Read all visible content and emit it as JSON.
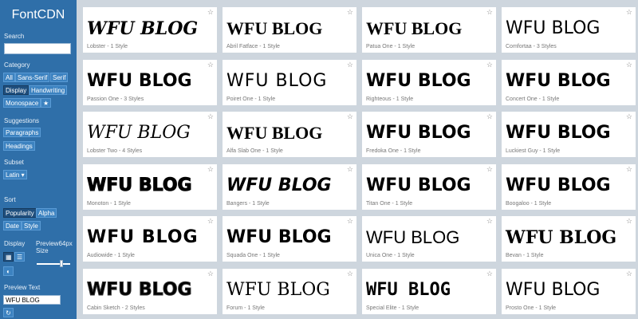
{
  "sidebar": {
    "title": "FontCDN",
    "search_label": "Search",
    "search_value": "",
    "category_label": "Category",
    "category_buttons": [
      "All",
      "Sans-Serif",
      "Serif",
      "Display",
      "Handwriting",
      "Monospace"
    ],
    "category_active": "Display",
    "favorites_icon": "star-icon",
    "suggestions_label": "Suggestions",
    "suggestion_buttons": [
      "Paragraphs",
      "Headings"
    ],
    "subset_label": "Subset",
    "subset_value": "Latin",
    "sort_label": "Sort",
    "sort_buttons": [
      "Popularity",
      "Alpha",
      "Date",
      "Style"
    ],
    "sort_active": "Popularity",
    "display_label": "Display",
    "display_icons": [
      "grid-view-icon",
      "list-view-icon",
      "contrast-icon"
    ],
    "preview_size_label": "Preview64px Size",
    "preview_size_value": "64px",
    "preview_text_label": "Preview Text",
    "preview_text_value": "WFU BLOG",
    "refresh_icon": "refresh-icon"
  },
  "preview_text": "WFU BLOG",
  "fonts": [
    {
      "name": "Lobster",
      "styles": "1 Style",
      "caption": "Lobster - 1 Style",
      "font_class": "f-lobster"
    },
    {
      "name": "Abril Fatface",
      "styles": "1 Style",
      "caption": "Abril Fatface - 1 Style",
      "font_class": "f-abril"
    },
    {
      "name": "Patua One",
      "styles": "1 Style",
      "caption": "Patua One - 1 Style",
      "font_class": "f-patua"
    },
    {
      "name": "Comfortaa",
      "styles": "3 Styles",
      "caption": "Comfortaa - 3 Styles",
      "font_class": "f-comfortaa"
    },
    {
      "name": "Passion One",
      "styles": "3 Styles",
      "caption": "Passion One - 3 Styles",
      "font_class": "f-passion"
    },
    {
      "name": "Poiret One",
      "styles": "1 Style",
      "caption": "Poiret One - 1 Style",
      "font_class": "f-poiret"
    },
    {
      "name": "Righteous",
      "styles": "1 Style",
      "caption": "Righteous - 1 Style",
      "font_class": "f-righteous"
    },
    {
      "name": "Concert One",
      "styles": "1 Style",
      "caption": "Concert One - 1 Style",
      "font_class": "f-concert"
    },
    {
      "name": "Lobster Two",
      "styles": "4 Styles",
      "caption": "Lobster Two - 4 Styles",
      "font_class": "f-lobster2"
    },
    {
      "name": "Alfa Slab One",
      "styles": "1 Style",
      "caption": "Alfa Slab One - 1 Style",
      "font_class": "f-alfa"
    },
    {
      "name": "Fredoka One",
      "styles": "1 Style",
      "caption": "Fredoka One - 1 Style",
      "font_class": "f-fredoka"
    },
    {
      "name": "Luckiest Guy",
      "styles": "1 Style",
      "caption": "Luckiest Guy - 1 Style",
      "font_class": "f-luckiest"
    },
    {
      "name": "Monoton",
      "styles": "1 Style",
      "caption": "Monoton - 1 Style",
      "font_class": "f-monoton"
    },
    {
      "name": "Bangers",
      "styles": "1 Style",
      "caption": "Bangers - 1 Style",
      "font_class": "f-bangers"
    },
    {
      "name": "Titan One",
      "styles": "1 Style",
      "caption": "Titan One - 1 Style",
      "font_class": "f-titan"
    },
    {
      "name": "Boogaloo",
      "styles": "1 Style",
      "caption": "Boogaloo - 1 Style",
      "font_class": "f-boogaloo"
    },
    {
      "name": "Audiowide",
      "styles": "1 Style",
      "caption": "Audiowide - 1 Style",
      "font_class": "f-audiowide"
    },
    {
      "name": "Squada One",
      "styles": "1 Style",
      "caption": "Squada One - 1 Style",
      "font_class": "f-squada"
    },
    {
      "name": "Unica One",
      "styles": "1 Style",
      "caption": "Unica One - 1 Style",
      "font_class": "f-unica"
    },
    {
      "name": "Bevan",
      "styles": "1 Style",
      "caption": "Bevan - 1 Style",
      "font_class": "f-bevan"
    },
    {
      "name": "Cabin Sketch",
      "styles": "2 Styles",
      "caption": "Cabin Sketch - 2 Styles",
      "font_class": "f-cabin"
    },
    {
      "name": "Forum",
      "styles": "1 Style",
      "caption": "Forum - 1 Style",
      "font_class": "f-forum"
    },
    {
      "name": "Special Elite",
      "styles": "1 Style",
      "caption": "Special Elite - 1 Style",
      "font_class": "f-special"
    },
    {
      "name": "Prosto One",
      "styles": "1 Style",
      "caption": "Prosto One - 1 Style",
      "font_class": "f-prosto"
    }
  ],
  "card_star_icon": "star-outline-icon",
  "colors": {
    "sidebar_bg": "#2f6fa9",
    "button_bg": "#3c82c0",
    "button_active_bg": "#1f4f7e",
    "page_bg": "#ced6de",
    "card_bg": "#ffffff"
  }
}
